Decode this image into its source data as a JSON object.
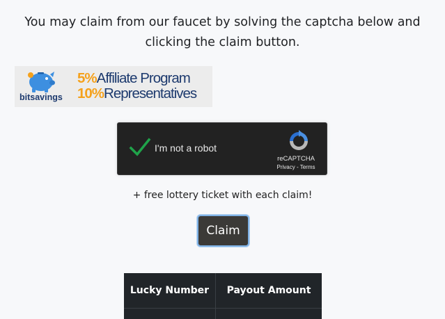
{
  "intro": {
    "line1": "You may claim from our faucet by solving the captcha below and",
    "line2": "clicking the claim button."
  },
  "banner": {
    "brand": "bitsavings",
    "line1_pct": "5%",
    "line1_text": "Affiliate Program",
    "line2_pct": "10%",
    "line2_text": "Representatives",
    "colors": {
      "accent": "#f5a11c",
      "text": "#1d3a6e",
      "pig": "#3d8fe0"
    }
  },
  "recaptcha": {
    "label": "I'm not a robot",
    "name": "reCAPTCHA",
    "privacy": "Privacy",
    "separator": " - ",
    "terms": "Terms",
    "checked": true,
    "check_color": "#1fa34a"
  },
  "lottery": {
    "text": "+ free lottery ticket with each claim!"
  },
  "claim": {
    "label": "Claim"
  },
  "table": {
    "headers": [
      "Lucky Number",
      "Payout Amount"
    ]
  }
}
